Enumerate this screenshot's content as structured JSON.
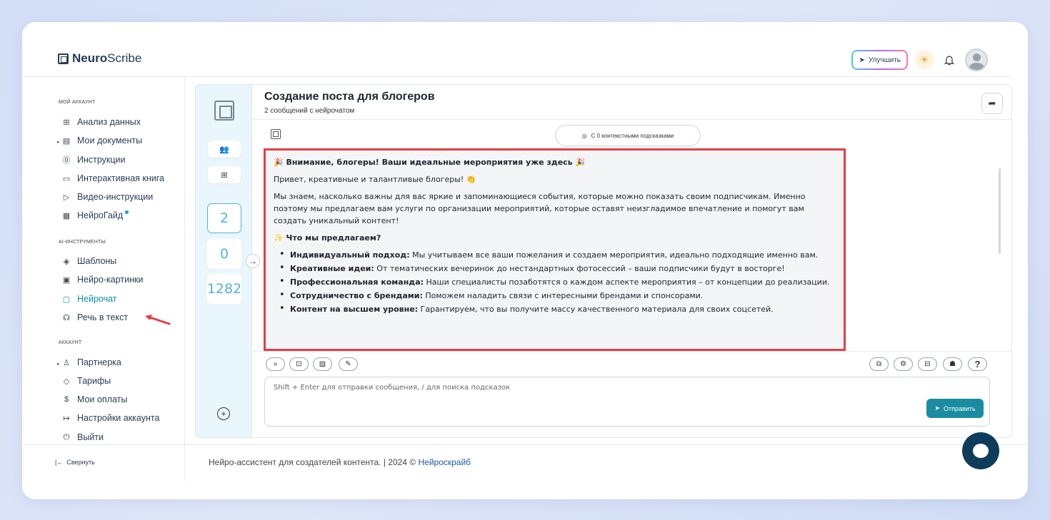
{
  "brand": {
    "name_bold": "Neuro",
    "name_light": "Scribe"
  },
  "header": {
    "upgrade_label": "Улучшить"
  },
  "sidebar": {
    "section_account": "МОЙ АККАУНТ",
    "account_items": [
      {
        "label": "Анализ данных",
        "icon": "grid-icon"
      },
      {
        "label": "Мои документы",
        "icon": "document-icon"
      },
      {
        "label": "Инструкции",
        "icon": "help-circle-icon"
      },
      {
        "label": "Интерактивная книга",
        "icon": "book-icon"
      },
      {
        "label": "Видео-инструкции",
        "icon": "video-icon"
      },
      {
        "label": "НейроГайд",
        "icon": "guide-icon"
      }
    ],
    "section_ai": "AI-ИНСТРУМЕНТЫ",
    "ai_items": [
      {
        "label": "Шаблоны",
        "icon": "layers-icon"
      },
      {
        "label": "Нейро-картинки",
        "icon": "image-icon"
      },
      {
        "label": "Нейрочат",
        "icon": "chat-icon"
      },
      {
        "label": "Речь в текст",
        "icon": "headphones-icon"
      }
    ],
    "section_acc": "АККАУНТ",
    "acc_items": [
      {
        "label": "Партнерка",
        "icon": "users-icon"
      },
      {
        "label": "Тарифы",
        "icon": "tag-icon"
      },
      {
        "label": "Мои оплаты",
        "icon": "dollar-icon"
      },
      {
        "label": "Настройки аккаунта",
        "icon": "settings-icon"
      },
      {
        "label": "Выйти",
        "icon": "power-icon"
      }
    ],
    "collapse_label": "Свернуть"
  },
  "footer": {
    "text": "Нейро-ассистент для создателей контента.  | 2024 © ",
    "link": "Нейроскрайб"
  },
  "rail": {
    "counters": [
      "2",
      "0",
      "1282"
    ]
  },
  "chat": {
    "title": "Создание поста для блогеров",
    "subtitle": "2 сообщений с нейрочатом",
    "context_pill": "С 0 контекстными подсказками",
    "message": {
      "heading": "🎉 Внимание, блогеры! Ваши идеальные мероприятия уже здесь 🎉",
      "greeting": "Привет, креативные и талантливые блогеры! 👏",
      "intro": "Мы знаем, насколько важны для вас яркие и запоминающиеся события, которые можно показать своим подписчикам. Именно поэтому мы предлагаем вам услуги по организации мероприятий, которые оставят неизгладимое впечатление и помогут вам создать уникальный контент!",
      "offer_heading": "✨ Что мы предлагаем?",
      "bullets": [
        {
          "bold": "Индивидуальный подход:",
          "text": " Мы учитываем все ваши пожелания и создаем мероприятия, идеально подходящие именно вам."
        },
        {
          "bold": "Креативные идеи:",
          "text": " От тематических вечеринок до нестандартных фотосессий – ваши подписчики будут в восторге!"
        },
        {
          "bold": "Профессиональная команда:",
          "text": " Наши специалисты позаботятся о каждом аспекте мероприятия – от концепции до реализации."
        },
        {
          "bold": "Сотрудничество с брендами:",
          "text": " Поможем наладить связи с интересными брендами и спонсорами."
        },
        {
          "bold": "Контент на высшем уровне:",
          "text": " Гарантируем, что вы получите массу качественного материала для своих соцсетей."
        }
      ]
    },
    "input_placeholder": "Shift + Enter для отправки сообщения, / для поиска подсказок",
    "send_label": "Отправить",
    "help_label": "?"
  },
  "colors": {
    "accent": "#1b8ca0",
    "highlight_border": "#e63d42",
    "annotation_arrow": "#e63d42"
  }
}
